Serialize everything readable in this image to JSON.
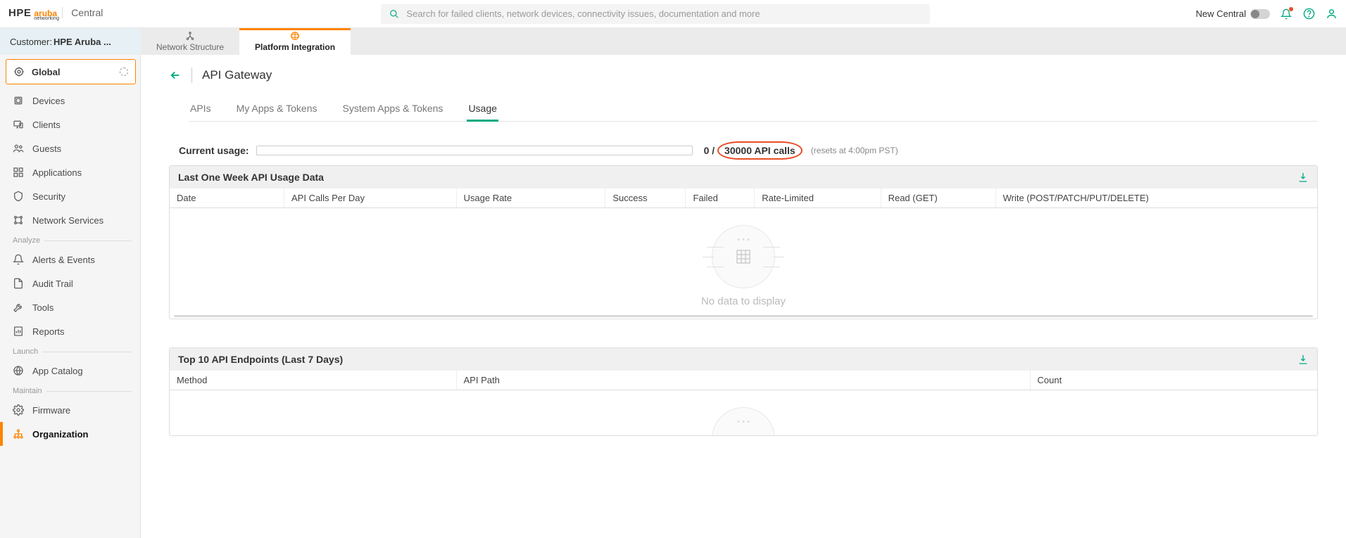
{
  "brand": {
    "hpe": "HPE",
    "aruba": "aruba",
    "sub": "networking",
    "product": "Central"
  },
  "search": {
    "placeholder": "Search for failed clients, network devices, connectivity issues, documentation and more"
  },
  "top_right": {
    "toggle_label": "New Central"
  },
  "customer_label": "Customer: ",
  "customer_value": "HPE Aruba ...",
  "secondary_tabs": {
    "network_structure": "Network Structure",
    "platform_integration": "Platform Integration"
  },
  "global_selector": "Global",
  "nav": {
    "devices": "Devices",
    "clients": "Clients",
    "guests": "Guests",
    "applications": "Applications",
    "security": "Security",
    "network_services": "Network Services",
    "section_analyze": "Analyze",
    "alerts": "Alerts & Events",
    "audit": "Audit Trail",
    "tools": "Tools",
    "reports": "Reports",
    "section_launch": "Launch",
    "app_catalog": "App Catalog",
    "section_maintain": "Maintain",
    "firmware": "Firmware",
    "organization": "Organization"
  },
  "page": {
    "title": "API Gateway"
  },
  "sub_tabs": {
    "apis": "APIs",
    "my_apps": "My Apps & Tokens",
    "system_apps": "System Apps & Tokens",
    "usage": "Usage"
  },
  "usage": {
    "label": "Current usage:",
    "current": "0",
    "sep": " / ",
    "max": "30000 API calls",
    "reset": "(resets at 4:00pm PST)"
  },
  "card1": {
    "title": "Last One Week API Usage Data",
    "cols": {
      "date": "Date",
      "calls": "API Calls Per Day",
      "rate": "Usage Rate",
      "success": "Success",
      "failed": "Failed",
      "ratelimited": "Rate-Limited",
      "read": "Read (GET)",
      "write": "Write (POST/PATCH/PUT/DELETE)"
    },
    "empty": "No data to display"
  },
  "card2": {
    "title": "Top 10 API Endpoints (Last 7 Days)",
    "cols": {
      "method": "Method",
      "path": "API Path",
      "count": "Count"
    }
  }
}
